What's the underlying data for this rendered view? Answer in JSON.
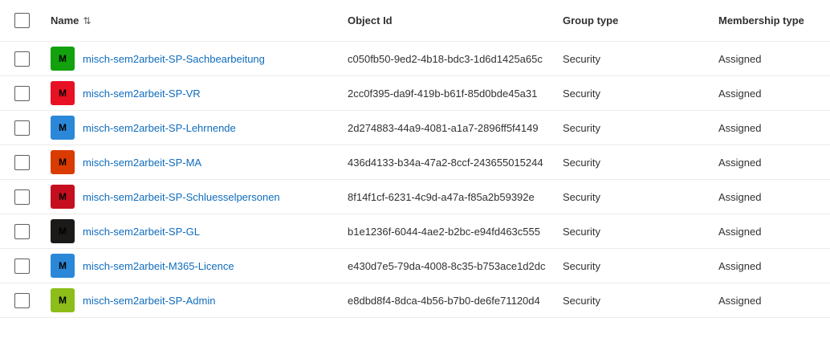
{
  "columns": {
    "name": "Name",
    "sort_icon": "⇅",
    "object_id": "Object Id",
    "group_type": "Group type",
    "membership_type": "Membership type"
  },
  "rows": [
    {
      "initial": "M",
      "avatar_color": "#13a10e",
      "name": "misch-sem2arbeit-SP-Sachbearbeitung",
      "object_id": "c050fb50-9ed2-4b18-bdc3-1d6d1425a65c",
      "group_type": "Security",
      "membership_type": "Assigned"
    },
    {
      "initial": "M",
      "avatar_color": "#e81123",
      "name": "misch-sem2arbeit-SP-VR",
      "object_id": "2cc0f395-da9f-419b-b61f-85d0bde45a31",
      "group_type": "Security",
      "membership_type": "Assigned"
    },
    {
      "initial": "M",
      "avatar_color": "#2b88d8",
      "name": "misch-sem2arbeit-SP-Lehrnende",
      "object_id": "2d274883-44a9-4081-a1a7-2896ff5f4149",
      "group_type": "Security",
      "membership_type": "Assigned"
    },
    {
      "initial": "M",
      "avatar_color": "#da3b01",
      "name": "misch-sem2arbeit-SP-MA",
      "object_id": "436d4133-b34a-47a2-8ccf-243655015244",
      "group_type": "Security",
      "membership_type": "Assigned"
    },
    {
      "initial": "M",
      "avatar_color": "#c50f1f",
      "name": "misch-sem2arbeit-SP-Schluesselpersonen",
      "object_id": "8f14f1cf-6231-4c9d-a47a-f85a2b59392e",
      "group_type": "Security",
      "membership_type": "Assigned"
    },
    {
      "initial": "M",
      "avatar_color": "#1b1a19",
      "name": "misch-sem2arbeit-SP-GL",
      "object_id": "b1e1236f-6044-4ae2-b2bc-e94fd463c555",
      "group_type": "Security",
      "membership_type": "Assigned"
    },
    {
      "initial": "M",
      "avatar_color": "#2b88d8",
      "name": "misch-sem2arbeit-M365-Licence",
      "object_id": "e430d7e5-79da-4008-8c35-b753ace1d2dc",
      "group_type": "Security",
      "membership_type": "Assigned"
    },
    {
      "initial": "M",
      "avatar_color": "#8cbd18",
      "name": "misch-sem2arbeit-SP-Admin",
      "object_id": "e8dbd8f4-8dca-4b56-b7b0-de6fe71120d4",
      "group_type": "Security",
      "membership_type": "Assigned"
    }
  ]
}
